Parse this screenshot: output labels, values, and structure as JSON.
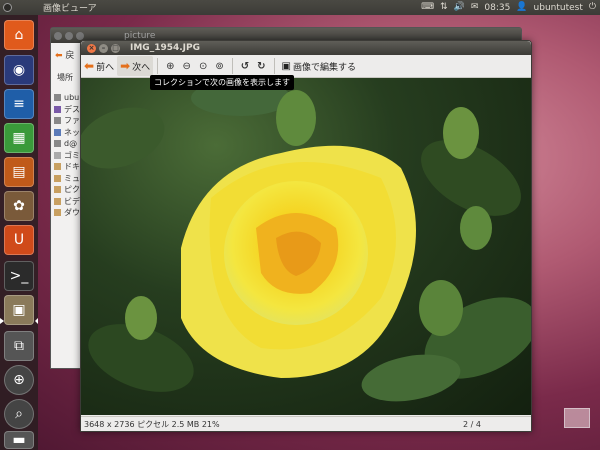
{
  "top_panel": {
    "app_name": "画像ビューア",
    "clock": "08:35",
    "user": "ubuntutest"
  },
  "file_manager": {
    "title": "picture",
    "back_label": "戻",
    "places_label": "場所",
    "sidebar_items": [
      "ubu",
      "デス",
      "ファ",
      "ネッ",
      "d@",
      "ゴミ",
      "ドキ",
      "ミュ",
      "ピク",
      "ビデ",
      "ダウ"
    ]
  },
  "viewer": {
    "title": "IMG_1954.JPG",
    "toolbar": {
      "prev_label": "前へ",
      "next_label": "次へ",
      "edit_label": "画像で編集する"
    },
    "tooltip": "コレクションで次の画像を表示します",
    "status_left": "3648 x 2736 ピクセル 2.5 MB   21%",
    "status_right": "2 / 4"
  },
  "colors": {
    "accent_orange": "#e46f1a",
    "close_button": "#f07746",
    "rose_yellow": "#f2e23a"
  }
}
